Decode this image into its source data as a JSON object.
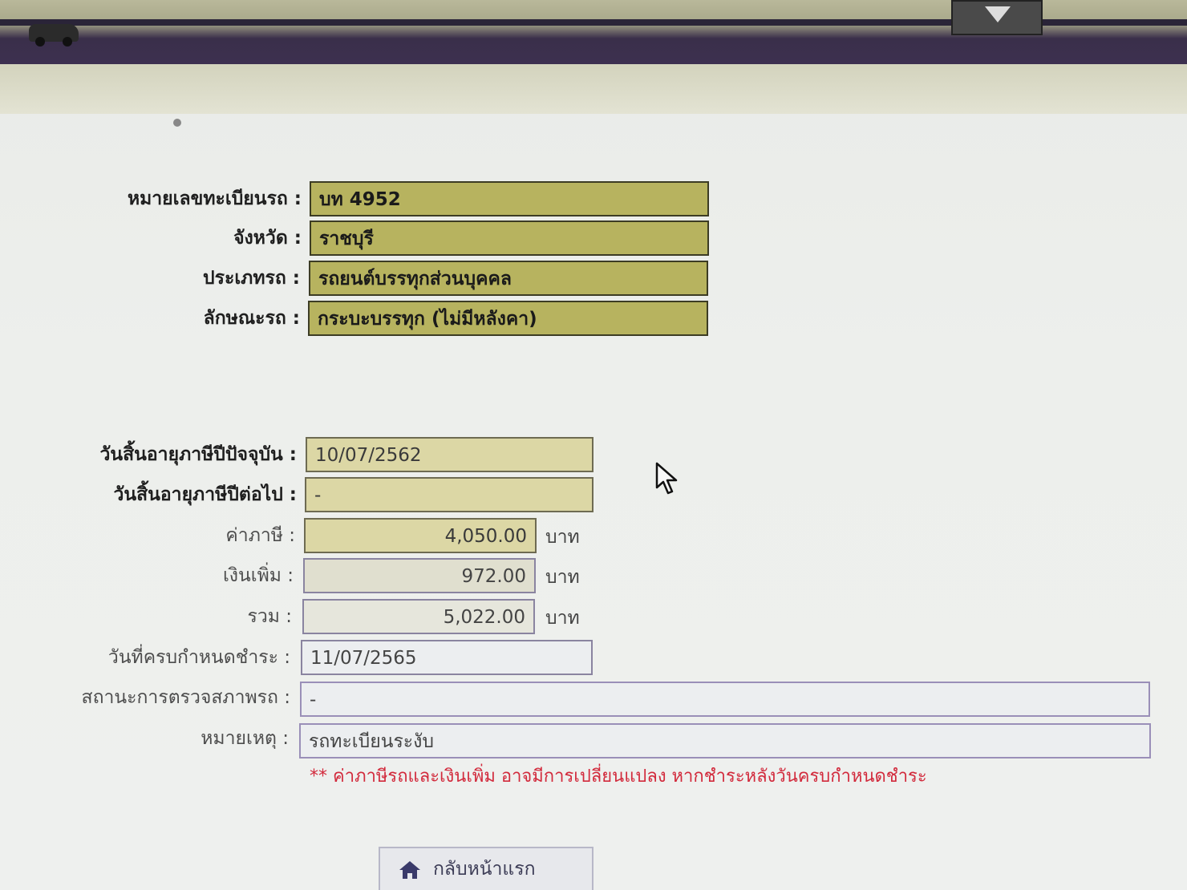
{
  "vehicle": {
    "plate_label": "หมายเลขทะเบียนรถ :",
    "plate_value": "บท 4952",
    "province_label": "จังหวัด :",
    "province_value": "ราชบุรี",
    "type_label": "ประเภทรถ :",
    "type_value": "รถยนต์บรรทุกส่วนบุคคล",
    "style_label": "ลักษณะรถ :",
    "style_value": "กระบะบรรทุก (ไม่มีหลังคา)"
  },
  "tax": {
    "current_expiry_label": "วันสิ้นอายุภาษีปีปัจจุบัน :",
    "current_expiry_value": "10/07/2562",
    "next_expiry_label": "วันสิ้นอายุภาษีปีต่อไป :",
    "next_expiry_value": "-",
    "tax_label": "ค่าภาษี :",
    "tax_value": "4,050.00",
    "surcharge_label": "เงินเพิ่ม :",
    "surcharge_value": "972.00",
    "total_label": "รวม :",
    "total_value": "5,022.00",
    "unit": "บาท",
    "due_label": "วันที่ครบกำหนดชำระ :",
    "due_value": "11/07/2565",
    "inspection_label": "สถานะการตรวจสภาพรถ :",
    "inspection_value": "-",
    "note_label": "หมายเหตุ :",
    "note_value": "รถทะเบียนระงับ"
  },
  "warning_text": "** ค่าภาษีรถและเงินเพิ่ม อาจมีการเปลี่ยนแปลง หากชำระหลังวันครบกำหนดชำระ",
  "home_button_label": "กลับหน้าแรก",
  "icons": {
    "header": "car-icon",
    "download": "download-icon",
    "home": "home-icon",
    "cursor": "mouse-cursor-icon"
  },
  "colors": {
    "olive_field": "#b7b35f",
    "tan_field": "#dcd7a5",
    "warning": "#d22a3c"
  }
}
